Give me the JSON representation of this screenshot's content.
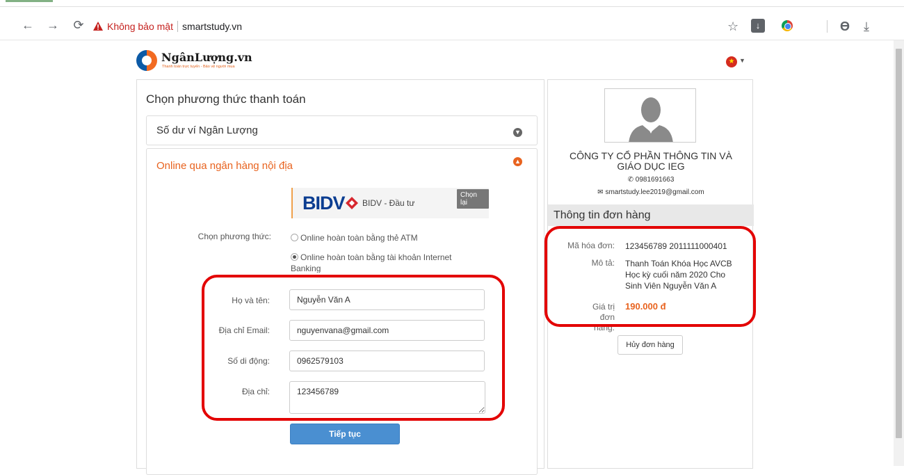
{
  "browser": {
    "security_warning": "Không bảo mật",
    "url": "smartstudy.vn",
    "icons": [
      "back-icon",
      "forward-icon",
      "reload-icon",
      "warning-icon",
      "star-icon",
      "download-extension-icon",
      "chrome-extension-icon",
      "profile-icon",
      "download-icon"
    ]
  },
  "header": {
    "logo_name": "NgânLượng.vn",
    "logo_tagline": "Thanh toán trực tuyến - Bảo vệ người mua",
    "language_flag": "vietnam-flag-icon"
  },
  "payment": {
    "title": "Chọn phương thức thanh toán",
    "option_wallet": "Số dư ví Ngân Lượng",
    "option_bank": "Online qua ngân hàng nội địa",
    "bank": {
      "logo_text": "BIDV",
      "name": "BIDV - Đầu tư",
      "reselect_label": "Chọn lại"
    },
    "method_label": "Chọn phương thức:",
    "methods": [
      {
        "label": "Online hoàn toàn bằng thẻ ATM",
        "selected": false
      },
      {
        "label": "Online hoàn toàn bằng tài khoản Internet Banking",
        "selected": true
      }
    ],
    "form": {
      "name_label": "Họ và tên:",
      "name_value": "Nguyễn Văn A",
      "email_label": "Địa chỉ Email:",
      "email_value": "nguyenvana@gmail.com",
      "phone_label": "Số di động:",
      "phone_value": "0962579103",
      "address_label": "Địa chỉ:",
      "address_value": "123456789"
    },
    "continue_label": "Tiếp tục"
  },
  "merchant": {
    "company_line1": "CÔNG TY CỔ PHẦN THÔNG TIN VÀ",
    "company_line2": "GIÁO DỤC IEG",
    "phone": "0981691663",
    "email": "smartstudy.lee2019@gmail.com"
  },
  "order": {
    "title": "Thông tin đơn hàng",
    "invoice_label": "Mã hóa đơn:",
    "invoice_value": "123456789 2011111000401",
    "desc_label": "Mô tả:",
    "desc_value": "Thanh Toán Khóa Học AVCB Học kỳ cuối năm 2020 Cho Sinh Viên Nguyễn Văn A",
    "value_label": "Giá trị đơn hàng:",
    "value": "190.000 đ",
    "cancel_label": "Hủy đơn hàng"
  },
  "colors": {
    "accent_orange": "#e8631f",
    "button_blue": "#4a8fd1",
    "highlight_red": "#e30000",
    "bidv_blue": "#0b3d91"
  }
}
